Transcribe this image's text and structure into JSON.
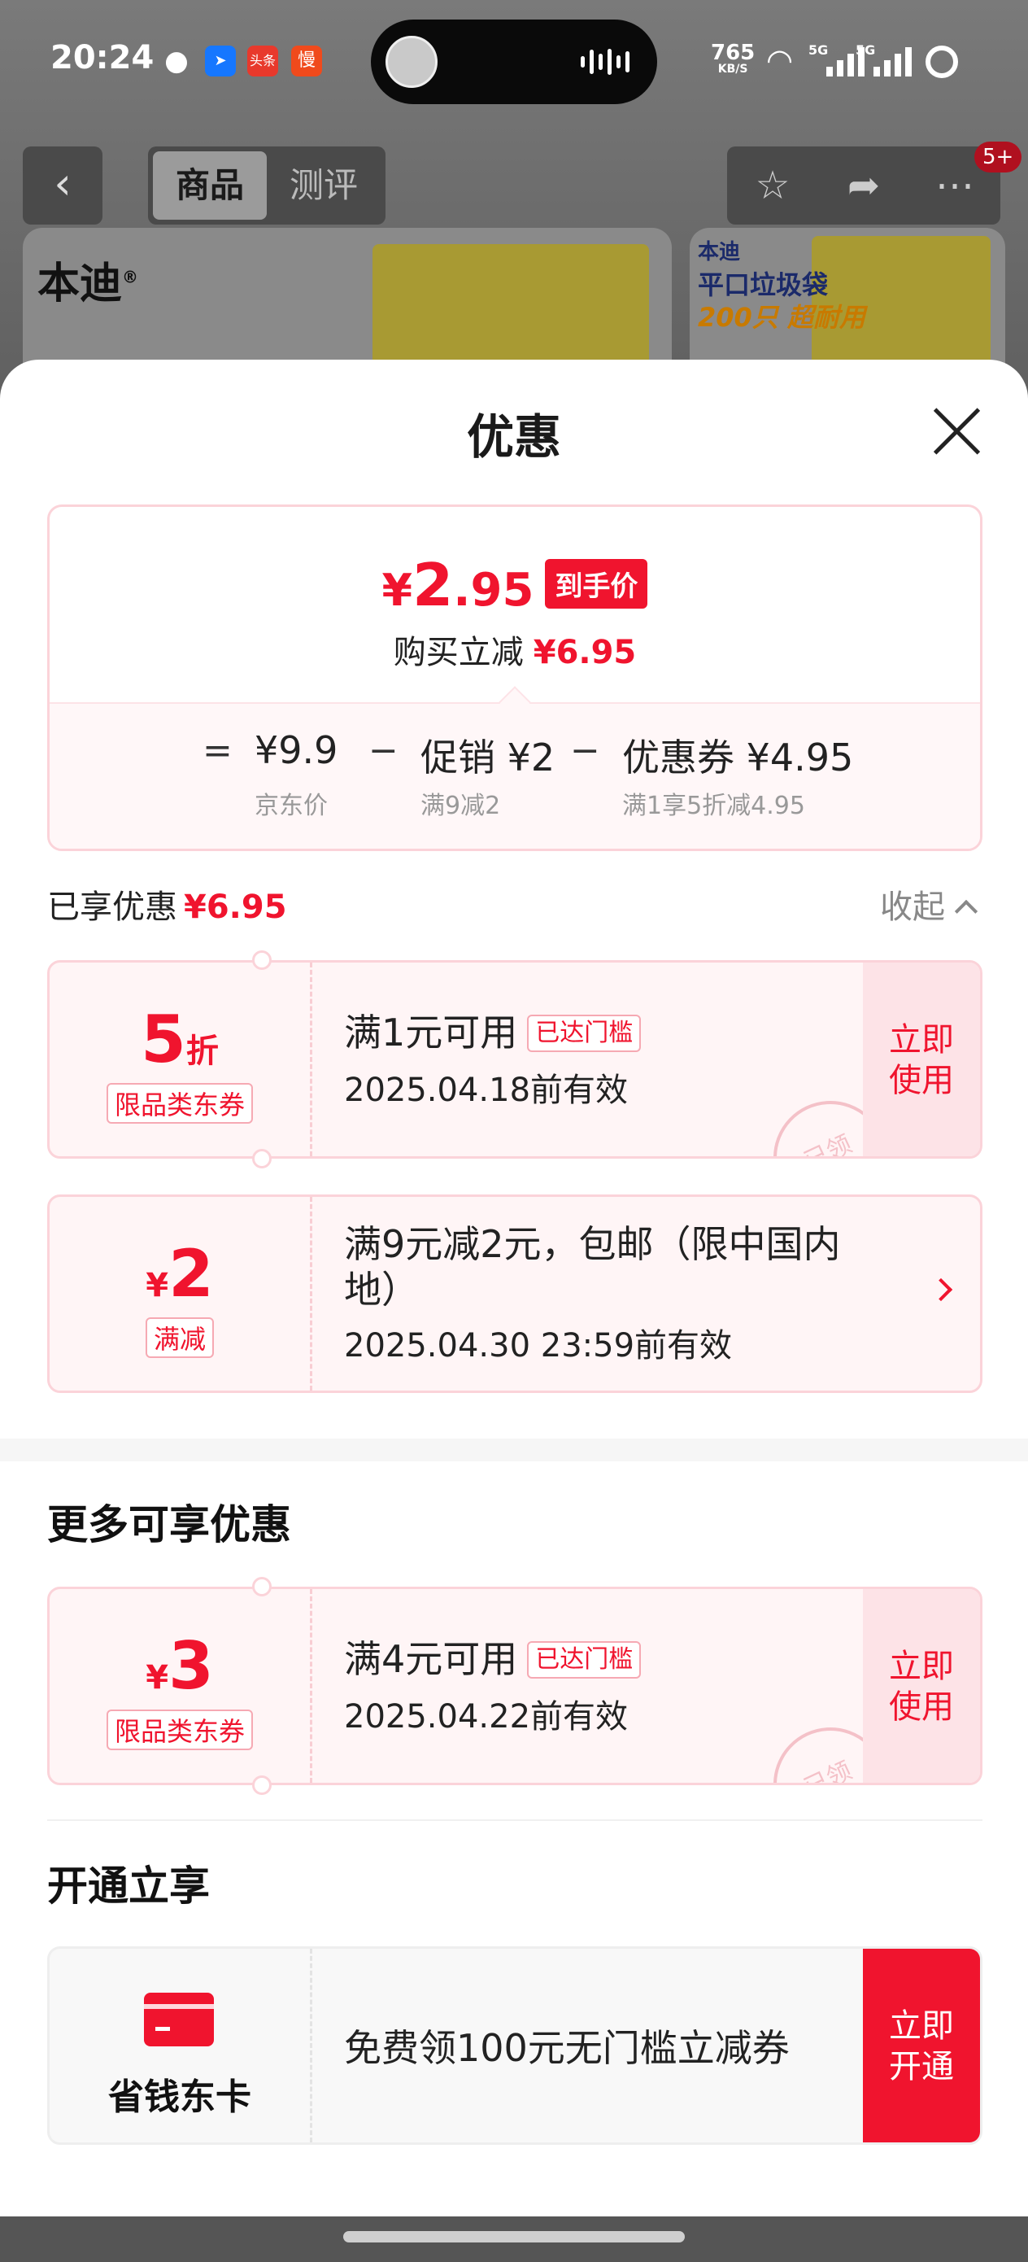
{
  "status_bar": {
    "time": "20:24",
    "apps": [
      "wechat-icon",
      "maps-icon",
      "toutiao-icon",
      "slow-app-icon"
    ],
    "app_labels": {
      "toutiao": "头条",
      "slow": "慢"
    },
    "net_speed": "765",
    "net_unit": "KB/S",
    "signal_labels": [
      "5G",
      "5G"
    ]
  },
  "nav": {
    "tabs": [
      {
        "label": "商品",
        "active": true
      },
      {
        "label": "测评",
        "active": false
      }
    ],
    "cart_badge": "5+"
  },
  "product": {
    "brand": "本迪",
    "brand_mark": "®",
    "promo_lines": [
      "本迪",
      "平口垃圾袋",
      "200只 超耐用"
    ]
  },
  "sheet": {
    "title": "优惠",
    "final_price": {
      "currency": "¥",
      "int": "2",
      "dec": ".95",
      "tag": "到手价"
    },
    "instant_saving_label": "购买立减",
    "instant_saving_value": "¥6.95",
    "calc": {
      "eq": "=",
      "minus": "−",
      "items": [
        {
          "value": "¥9.9",
          "sub": "京东价"
        },
        {
          "value": "促销 ¥2",
          "sub": "满9减2"
        },
        {
          "value": "优惠券 ¥4.95",
          "sub": "满1享5折减4.95"
        }
      ]
    },
    "enjoyed_label": "已享优惠",
    "enjoyed_value": "¥6.95",
    "collapse_label": "收起",
    "enjoyed_coupons": [
      {
        "amount": "5",
        "unit": "折",
        "type": "限品类东券",
        "condition": "满1元可用",
        "badge": "已达门槛",
        "expiry": "2025.04.18前有效",
        "action": "立即使用",
        "stamp": "已领"
      },
      {
        "currency": "¥",
        "amount": "2",
        "type": "满减",
        "condition": "满9元减2元，包邮（限中国内地）",
        "expiry": "2025.04.30 23:59前有效"
      }
    ],
    "more_title": "更多可享优惠",
    "more_coupons": [
      {
        "currency": "¥",
        "amount": "3",
        "type": "限品类东券",
        "condition": "满4元可用",
        "badge": "已达门槛",
        "expiry": "2025.04.22前有效",
        "action": "立即使用",
        "stamp": "已领"
      }
    ],
    "open_title": "开通立享",
    "membership": {
      "name": "省钱东卡",
      "desc": "免费领100元无门槛立减券",
      "action": "立即开通"
    }
  }
}
